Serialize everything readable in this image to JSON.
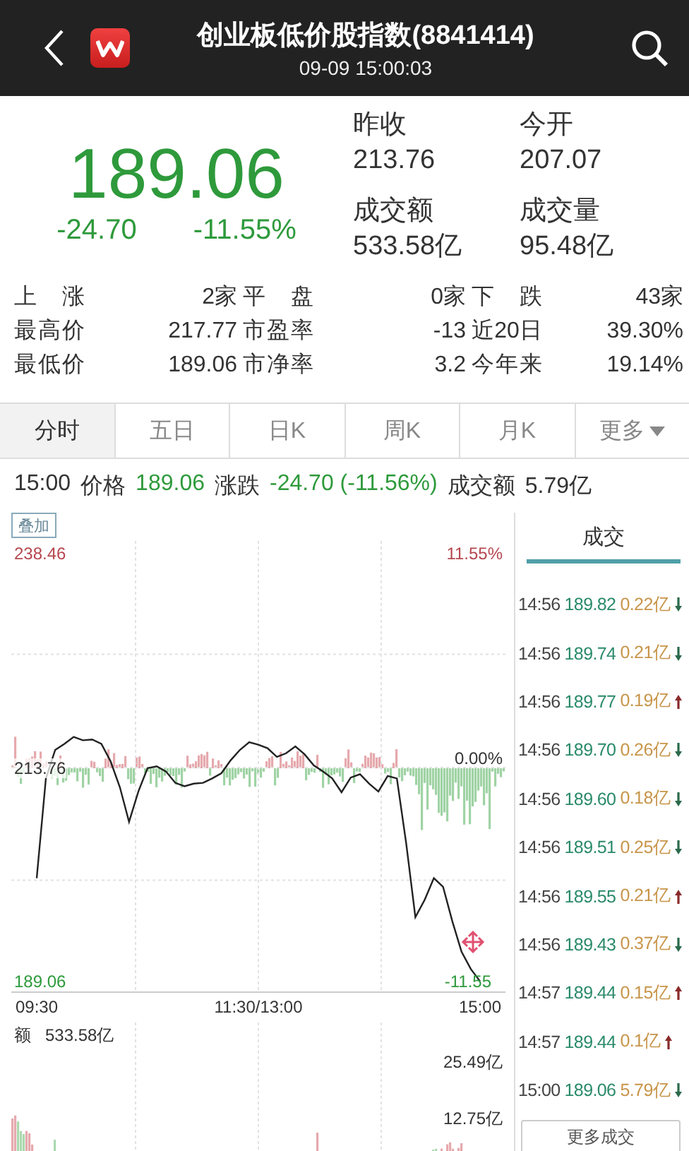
{
  "header": {
    "title": "创业板低价股指数(8841414)",
    "datetime": "09-09 15:00:03"
  },
  "quote": {
    "price": "189.06",
    "change": "-24.70",
    "change_pct": "-11.55%",
    "stats": [
      {
        "label": "昨收",
        "value": "213.76"
      },
      {
        "label": "今开",
        "value": "207.07"
      },
      {
        "label": "成交额",
        "value": "533.58亿"
      },
      {
        "label": "成交量",
        "value": "95.48亿"
      }
    ]
  },
  "market_stats": [
    {
      "label": "上 涨",
      "value": "2家"
    },
    {
      "label": "平 盘",
      "value": "0家"
    },
    {
      "label": "下 跌",
      "value": "43家"
    },
    {
      "label": "最高价",
      "value": "217.77"
    },
    {
      "label": "市盈率",
      "value": "-13"
    },
    {
      "label": "近20日",
      "value": "39.30%"
    },
    {
      "label": "最低价",
      "value": "189.06"
    },
    {
      "label": "市净率",
      "value": "3.2"
    },
    {
      "label": "今年来",
      "value": "19.14%"
    }
  ],
  "tabs": [
    {
      "label": "分时",
      "selected": true,
      "kind": "tab"
    },
    {
      "label": "五日",
      "selected": false,
      "kind": "tab"
    },
    {
      "label": "日K",
      "selected": false,
      "kind": "tab"
    },
    {
      "label": "周K",
      "selected": false,
      "kind": "tab"
    },
    {
      "label": "月K",
      "selected": false,
      "kind": "tab"
    },
    {
      "label": "更多",
      "selected": false,
      "kind": "menu"
    }
  ],
  "tick_info": {
    "time": "15:00",
    "price_label": "价格",
    "price": "189.06",
    "change_label": "涨跌",
    "change": "-24.70 (-11.56%)",
    "amount_label": "成交额",
    "amount": "5.79亿"
  },
  "chart": {
    "overlay_button": "叠加",
    "pct_max": "11.55%",
    "pct_mid": "0.00%",
    "pct_min": "-11.55",
    "chart_data": {
      "type": "line",
      "categories": [
        "09:30",
        null,
        null,
        null,
        null,
        null,
        null,
        null,
        null,
        null,
        null,
        null,
        null,
        null,
        null,
        null,
        null,
        null,
        null,
        null,
        null,
        null,
        null,
        null,
        "11:30/13:00",
        null,
        null,
        null,
        null,
        null,
        null,
        null,
        null,
        null,
        null,
        null,
        null,
        null,
        null,
        null,
        null,
        null,
        null,
        null,
        null,
        null,
        null,
        null,
        "15:00"
      ],
      "series": [
        {
          "color": "#222222",
          "values": [
            201.0,
            212.5,
            215.8,
            216.5,
            217.3,
            216.9,
            217.0,
            216.5,
            214.5,
            211.5,
            207.5,
            211.0,
            213.7,
            213.9,
            213.3,
            212.0,
            211.6,
            211.9,
            212.0,
            212.5,
            213.1,
            214.6,
            215.8,
            216.7,
            216.4,
            216.0,
            215.0,
            215.4,
            216.2,
            215.3,
            214.0,
            213.3,
            212.5,
            210.9,
            212.6,
            213.0,
            211.9,
            211.0,
            212.8,
            212.5,
            205.0,
            196.5,
            198.5,
            201.0,
            200.0,
            196.0,
            192.5,
            190.5,
            189.1
          ]
        }
      ],
      "ylim": [
        189.06,
        238.46
      ],
      "yticks": [
        {
          "value": 189.06,
          "label": "189.06"
        },
        {
          "value": 213.76,
          "label": "213.76"
        },
        {
          "value": 238.46,
          "label": "238.46"
        }
      ]
    },
    "volume_label": "额",
    "volume_total": "533.58亿",
    "volume_ticks": [
      "25.49亿",
      "12.75亿"
    ]
  },
  "trades": {
    "tab": "成交",
    "rows": [
      {
        "time": "14:56",
        "price": "189.82",
        "amount": "0.22亿",
        "rising": false
      },
      {
        "time": "14:56",
        "price": "189.74",
        "amount": "0.21亿",
        "rising": false
      },
      {
        "time": "14:56",
        "price": "189.77",
        "amount": "0.19亿",
        "rising": true
      },
      {
        "time": "14:56",
        "price": "189.70",
        "amount": "0.26亿",
        "rising": false
      },
      {
        "time": "14:56",
        "price": "189.60",
        "amount": "0.18亿",
        "rising": false
      },
      {
        "time": "14:56",
        "price": "189.51",
        "amount": "0.25亿",
        "rising": false
      },
      {
        "time": "14:56",
        "price": "189.55",
        "amount": "0.21亿",
        "rising": true
      },
      {
        "time": "14:56",
        "price": "189.43",
        "amount": "0.37亿",
        "rising": false
      },
      {
        "time": "14:57",
        "price": "189.44",
        "amount": "0.15亿",
        "rising": true
      },
      {
        "time": "14:57",
        "price": "189.44",
        "amount": "0.1亿",
        "rising": true
      },
      {
        "time": "15:00",
        "price": "189.06",
        "amount": "5.79亿",
        "rising": false
      }
    ],
    "more_button": "更多成交"
  }
}
